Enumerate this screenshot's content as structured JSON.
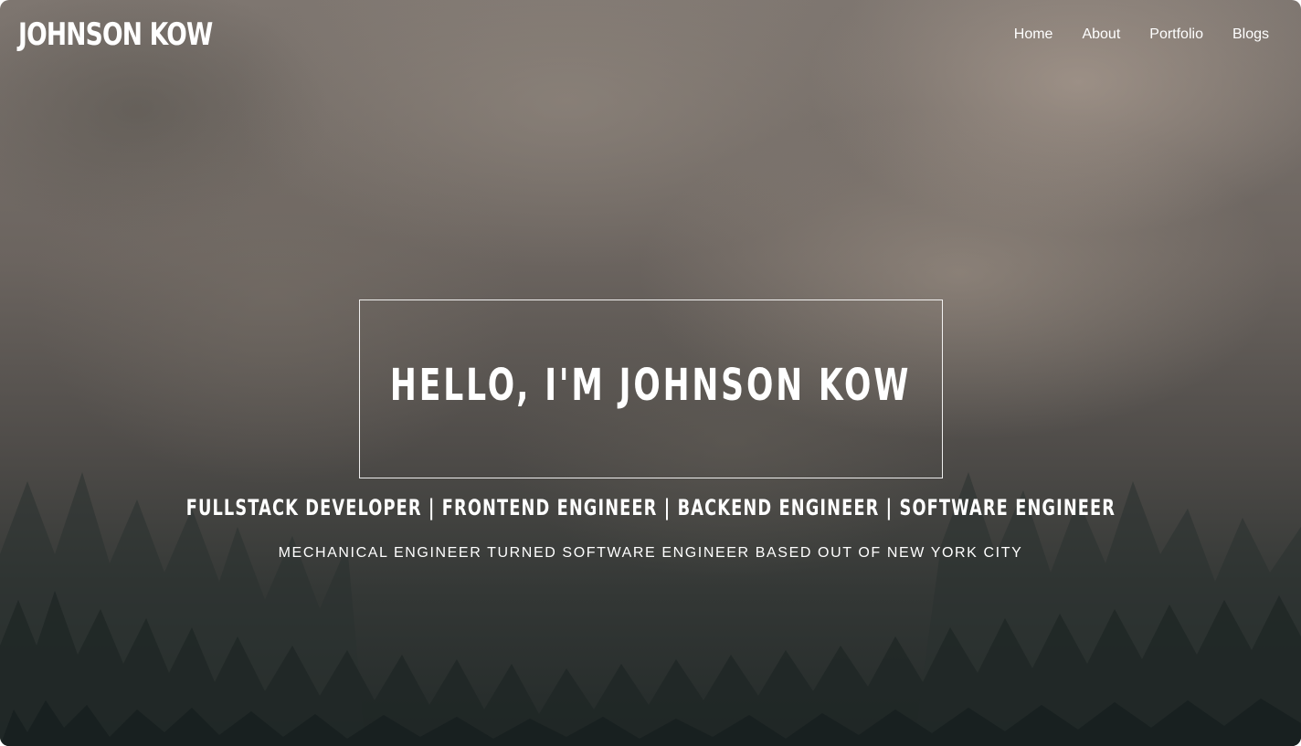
{
  "nav": {
    "brand": "JOHNSON KOW",
    "links": [
      {
        "label": "Home"
      },
      {
        "label": "About"
      },
      {
        "label": "Portfolio"
      },
      {
        "label": "Blogs"
      }
    ]
  },
  "hero": {
    "title": "HELLO, I'M JOHNSON KOW",
    "roles": "FULLSTACK DEVELOPER | FRONTEND ENGINEER | BACKEND ENGINEER | SOFTWARE ENGINEER",
    "tagline": "MECHANICAL ENGINEER TURNED SOFTWARE ENGINEER BASED OUT OF NEW YORK CITY"
  },
  "background": {
    "image": "misty-forest",
    "colors": {
      "fog": "#8a817a",
      "forest": "#232a29",
      "text": "#ffffff"
    }
  }
}
